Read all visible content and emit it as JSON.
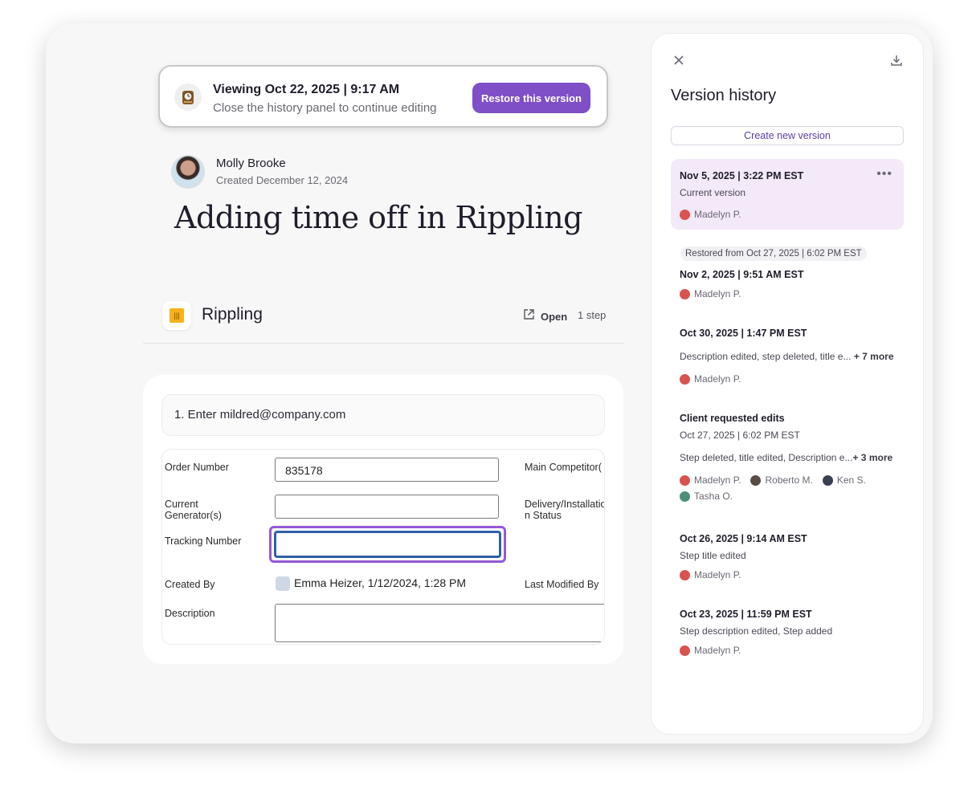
{
  "banner": {
    "title": "Viewing Oct 22, 2025 | 9:17 AM",
    "subtitle": "Close the history panel to continue editing",
    "restore_label": "Restore this version",
    "icon": "clock-icon"
  },
  "author": {
    "name": "Molly Brooke",
    "created": "Created December 12, 2024"
  },
  "doc_title": "Adding time off in Rippling",
  "app_row": {
    "name": "Rippling",
    "open_label": "Open",
    "steps": "1 step",
    "logo_color": "#f6b21b"
  },
  "step": {
    "instruction": "1. Enter mildred@company.com",
    "form": {
      "order_number_label": "Order Number",
      "order_number_value": "835178",
      "main_competitor_label": "Main Competitor(",
      "current_generator_label_1": "Current",
      "current_generator_label_2": "Generator(s)",
      "delivery_label_1": "Delivery/Installatio",
      "delivery_label_2": "n Status",
      "tracking_label": "Tracking Number",
      "created_by_label": "Created By",
      "created_by_value": "Emma Heizer, 1/12/2024, 1:28 PM",
      "last_modified_label": "Last Modified By",
      "description_label": "Description"
    }
  },
  "panel": {
    "title": "Version history",
    "create_label": "Create new version",
    "versions": [
      {
        "title": "Nov 5, 2025 | 3:22 PM EST",
        "subtitle": "Current version",
        "users": [
          "Madelyn P."
        ]
      },
      {
        "badge": "Restored from Oct 27, 2025 | 6:02 PM EST",
        "title": "Nov 2, 2025 | 9:51 AM EST",
        "users": [
          "Madelyn P."
        ]
      },
      {
        "title": "Oct 30, 2025 | 1:47 PM EST",
        "changes": "Description edited, step deleted, title e...",
        "more": "+ 7 more",
        "users": [
          "Madelyn P."
        ]
      },
      {
        "title": "Client requested edits",
        "subtitle": "Oct 27, 2025 | 6:02 PM EST",
        "changes": "Step deleted, title edited, Description e...",
        "more": "+ 3 more",
        "users": [
          "Madelyn P.",
          "Roberto M.",
          "Ken S.",
          "Tasha O."
        ]
      },
      {
        "title": "Oct 26, 2025 | 9:14 AM EST",
        "subtitle": "Step title edited",
        "users": [
          "Madelyn P."
        ]
      },
      {
        "title": "Oct 23, 2025 | 11:59 PM EST",
        "subtitle": "Step description edited, Step added",
        "users": [
          "Madelyn P."
        ]
      }
    ]
  },
  "colors": {
    "accent": "#7e4fc6",
    "current_version_bg": "#f3e9f8",
    "focus_outer": "#9458d6",
    "focus_inner": "#2f5fa8"
  }
}
